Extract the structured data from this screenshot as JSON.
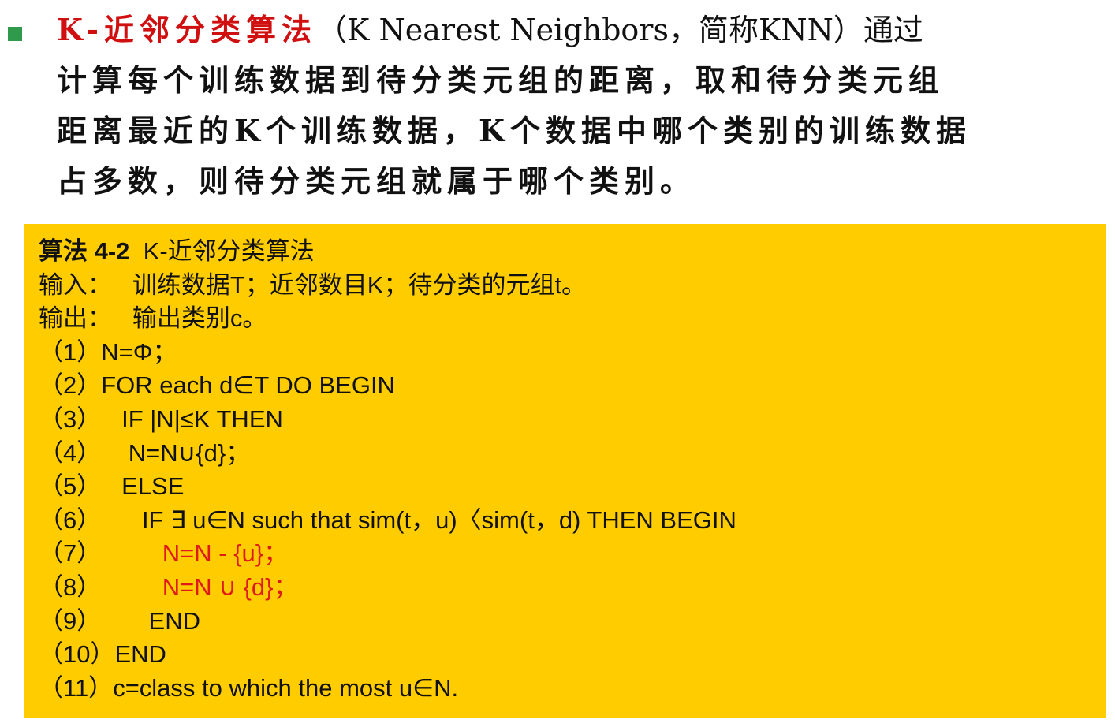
{
  "intro": {
    "title_red": "K-近邻分类算法",
    "line1_rest": "（K Nearest Neighbors，简称KNN）通过",
    "line2": "计算每个训练数据到待分类元组的距离，取和待分类元组",
    "line3": "距离最近的K个训练数据，K个数据中哪个类别的训练数据",
    "line4": "占多数，则待分类元组就属于哪个类别。"
  },
  "algorithm": {
    "heading_bold": "算法 4-2",
    "heading_name": "K-近邻分类算法",
    "input_label": "输入：",
    "input_text": "训练数据T；近邻数目K；待分类的元组t。",
    "output_label": "输出：",
    "output_text": "输出类别c。",
    "steps": [
      {
        "num": "（1）",
        "code": "N=Φ；"
      },
      {
        "num": "（2）",
        "code": "FOR each d∈T DO BEGIN"
      },
      {
        "num": "（3）",
        "code": "IF |N|≤K THEN"
      },
      {
        "num": "（4）",
        "code": "N=N∪{d}；"
      },
      {
        "num": "（5）",
        "code": "ELSE"
      },
      {
        "num": "（6）",
        "code": "IF ∃ u∈N such that sim(t，u)〈sim(t，d) THEN BEGIN"
      },
      {
        "num": "（7）",
        "code": "N=N - {u}；"
      },
      {
        "num": "（8）",
        "code": "N=N ∪ {d}；"
      },
      {
        "num": "（9）",
        "code": "END"
      },
      {
        "num": "（10）",
        "code": "END"
      },
      {
        "num": "（11）",
        "code": "c=class to which the most u∈N."
      }
    ]
  },
  "colors": {
    "bullet": "#2f9a4c",
    "accent_red": "#d01010",
    "box_background": "#ffcc00",
    "highlight_red": "#e01a1a"
  },
  "icons": {
    "bullet": "square-bullet-icon"
  }
}
